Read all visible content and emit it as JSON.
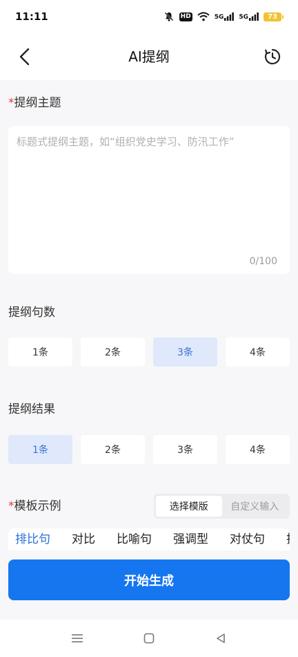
{
  "status_bar": {
    "time": "11:11",
    "hd_label": "HD",
    "signal1_label": "5G",
    "signal2_label": "5G",
    "battery_level": "73",
    "icons": [
      "mute-bell-icon",
      "hd-icon",
      "wifi-icon",
      "signal-5g-icon",
      "signal-5g-icon",
      "battery-icon"
    ]
  },
  "header": {
    "title": "AI提纲",
    "back_icon": "chevron-left-icon",
    "history_icon": "history-clock-icon"
  },
  "topic": {
    "required_mark": "*",
    "label": "提纲主题",
    "placeholder": "标题式提纲主题，如“组织党史学习、防汛工作”",
    "counter": "0/100"
  },
  "sentence_count": {
    "label": "提纲句数",
    "options": [
      "1条",
      "2条",
      "3条",
      "4条"
    ],
    "selected_index": 2
  },
  "result_count": {
    "label": "提纲结果",
    "options": [
      "1条",
      "2条",
      "3条",
      "4条"
    ],
    "selected_index": 0
  },
  "template": {
    "required_mark": "*",
    "label": "模板示例",
    "segments": [
      "选择模版",
      "自定义输入"
    ],
    "active_segment": 0,
    "tabs": [
      "排比句",
      "对比",
      "比喻句",
      "强调型",
      "对仗句",
      "排"
    ],
    "active_tab": 0
  },
  "actions": {
    "start_label": "开始生成"
  },
  "colors": {
    "accent": "#1576f0",
    "selected_bg": "#dfe9fb",
    "selected_text": "#3f6fd4",
    "required": "#e2432f",
    "battery": "#f2c230"
  },
  "nav_bar": {
    "icons": [
      "menu-icon",
      "home-square-icon",
      "back-triangle-icon"
    ]
  }
}
